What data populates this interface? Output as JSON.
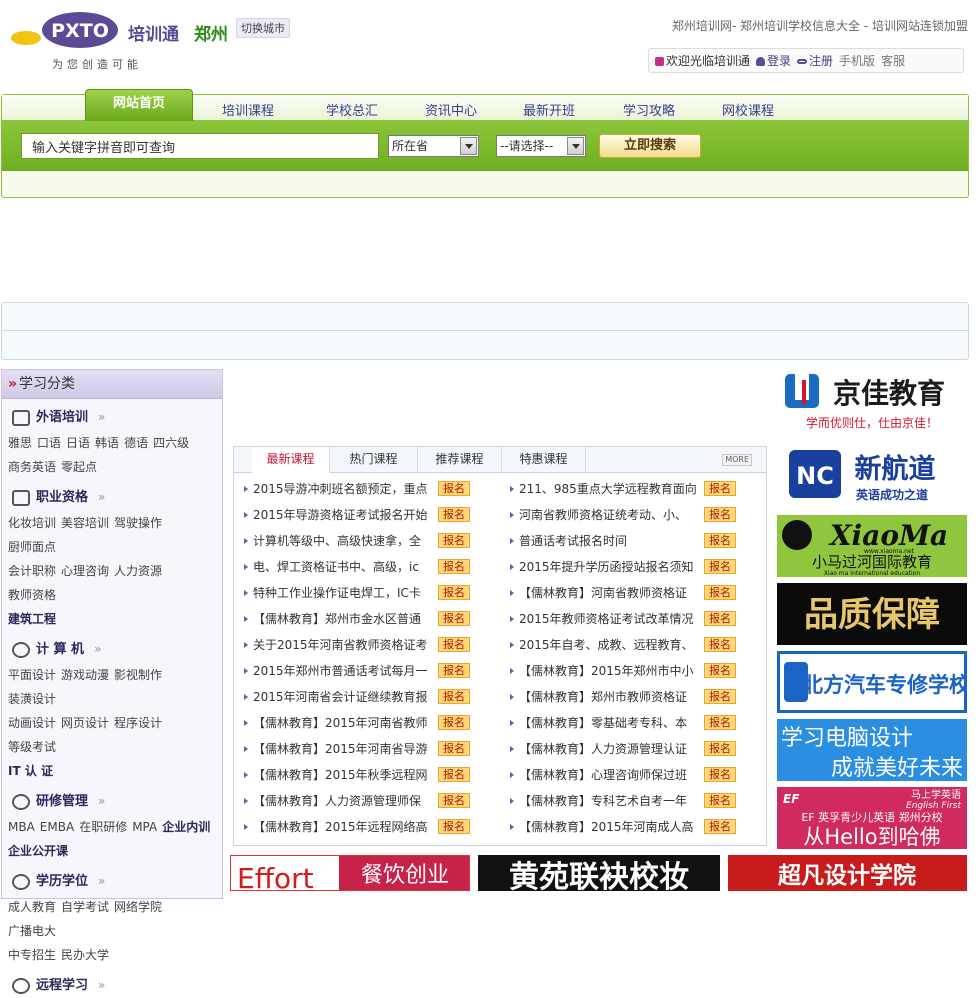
{
  "header": {
    "logo_text": "PXTO",
    "brand": "培训通",
    "city": "郑州",
    "switch_city": "切换城市",
    "tagline": "为您创造可能",
    "site_desc": "郑州培训网- 郑州培训学校信息大全 - 培训网站连锁加盟",
    "welcome": "欢迎光临培训通",
    "login": "登录",
    "register": "注册",
    "mobile": "手机版",
    "service": "客服"
  },
  "nav": {
    "home": "网站首页",
    "items": [
      "培训课程",
      "学校总汇",
      "资讯中心",
      "最新开班",
      "学习攻略",
      "网校课程"
    ]
  },
  "search": {
    "placeholder": "输入关键字拼音即可查询",
    "province": "所在省",
    "choose": "--请选择--",
    "button": "立即搜索"
  },
  "sidebar": {
    "title": "学习分类",
    "categories": [
      {
        "name": "外语培训",
        "links": [
          "雅思",
          "口语",
          "日语",
          "韩语",
          "德语",
          "四六级",
          "商务英语",
          "零起点"
        ],
        "bold": []
      },
      {
        "name": "职业资格",
        "links": [
          "化妆培训",
          "美容培训",
          "驾驶操作",
          "厨师面点",
          "会计职称",
          "心理咨询",
          "人力资源",
          "教师资格"
        ],
        "bold": [
          "建筑工程"
        ]
      },
      {
        "name": "计 算 机",
        "links": [
          "平面设计",
          "游戏动漫",
          "影视制作",
          "装潢设计",
          "动画设计",
          "网页设计",
          "程序设计",
          "等级考试"
        ],
        "bold": [
          "IT 认 证"
        ]
      },
      {
        "name": "研修管理",
        "links": [
          "MBA",
          "EMBA",
          "在职研修",
          "MPA"
        ],
        "bold": [
          "企业内训",
          "企业公开课"
        ]
      },
      {
        "name": "学历学位",
        "links": [
          "成人教育",
          "自学考试",
          "网络学院",
          "广播电大",
          "中专招生",
          "民办大学"
        ],
        "bold": []
      },
      {
        "name": "远程学习",
        "links": [],
        "bold": []
      }
    ]
  },
  "courses": {
    "tabs": [
      "最新课程",
      "热门课程",
      "推荐课程",
      "特惠课程"
    ],
    "more": "MORE",
    "apply": "报名",
    "left": [
      "2015导游冲刺班名额预定，重点",
      "2015年导游资格证考试报名开始",
      "计算机等级中、高级快速拿，全",
      "电、焊工资格证书中、高级，ic",
      "特种工作业操作证电焊工，IC卡",
      "【儒林教育】郑州市金水区普通",
      "关于2015年河南省教师资格证考",
      "2015年郑州市普通话考试每月一",
      "2015年河南省会计证继续教育报",
      "【儒林教育】2015年河南省教师",
      "【儒林教育】2015年河南省导游",
      "【儒林教育】2015年秋季远程网",
      "【儒林教育】人力资源管理师保",
      "【儒林教育】2015年远程网络高"
    ],
    "right": [
      "211、985重点大学远程教育面向",
      "河南省教师资格证统考动、小、",
      "普通话考试报名时间",
      "2015年提升学历函授站报名须知",
      "【儒林教育】河南省教师资格证",
      "2015年教师资格证考试改革情况",
      "2015年自考、成教、远程教育、",
      "【儒林教育】2015年郑州市中小",
      "【儒林教育】郑州市教师资格证",
      "【儒林教育】零基础考专科、本",
      "【儒林教育】人力资源管理认证",
      "【儒林教育】心理咨询师保过班",
      "【儒林教育】专科艺术自考一年",
      "【儒林教育】2015年河南成人高"
    ]
  },
  "ads": {
    "jingjia_title": "京佳教育",
    "jingjia_slogan": "学而优则仕，仕由京佳！",
    "nc_title": "新航道",
    "nc_slogan": "英语成功之道",
    "xiaoma_title": "XiaoMa",
    "xiaoma_url": "www.xiaoma.net",
    "xiaoma_cn": "小马过河国际教育",
    "xiaoma_en": "Xiao ma international education",
    "pinzhi": "品质保障",
    "beifang": "北方汽车专修学校",
    "diannao_1": "学习电脑设计",
    "diannao_2": "成就美好未来",
    "ef_top": "马上学英语",
    "ef_brand": "English First",
    "ef_line": "EF 英孚青少儿英语 郑州分校",
    "ef_slogan": "从Hello到哈佛",
    "bottom_1a": "Effort",
    "bottom_1b": "餐饮创业",
    "bottom_2": "黄苑联袂校妆",
    "bottom_3": "超凡设计学院"
  }
}
